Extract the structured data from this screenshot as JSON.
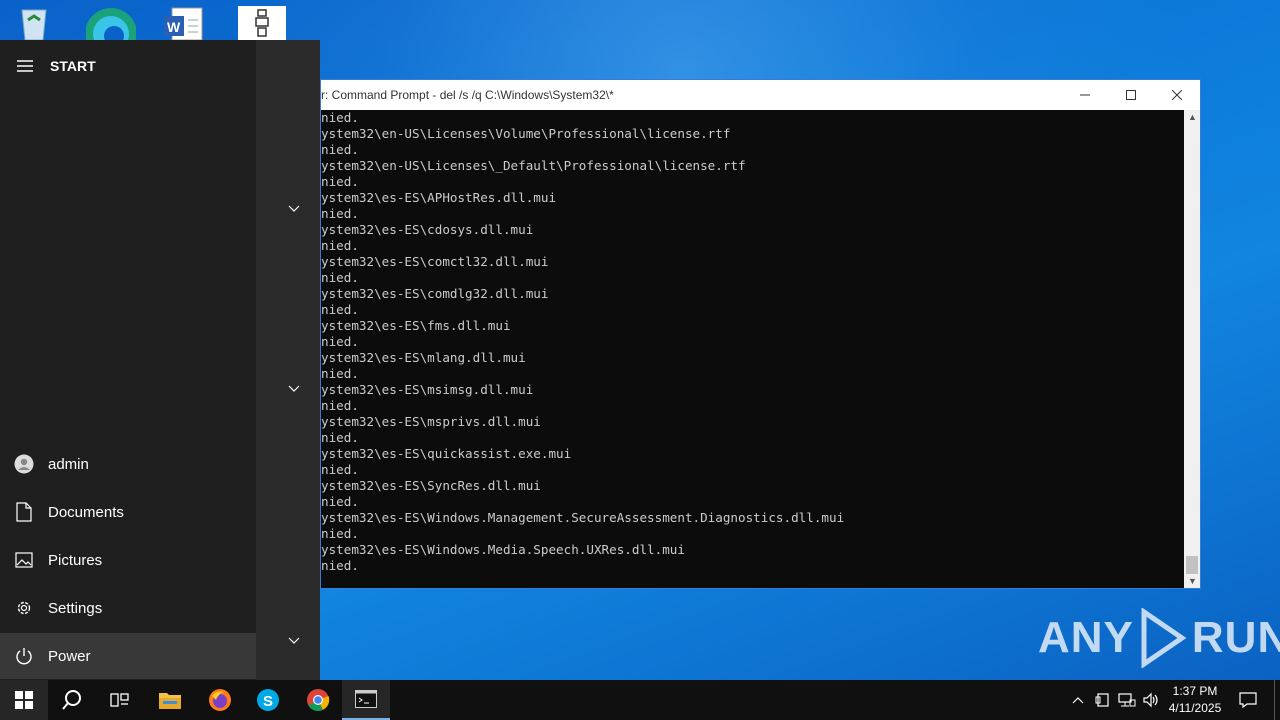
{
  "desktop": {
    "icons": [
      "recycle-bin-icon",
      "edge-icon",
      "word-document-icon",
      "application-icon"
    ]
  },
  "cmd_window": {
    "title": "r: Command Prompt - del  /s /q C:\\Windows\\System32\\*",
    "lines": [
      "nied.",
      "ystem32\\en-US\\Licenses\\Volume\\Professional\\license.rtf",
      "nied.",
      "ystem32\\en-US\\Licenses\\_Default\\Professional\\license.rtf",
      "nied.",
      "ystem32\\es-ES\\APHostRes.dll.mui",
      "nied.",
      "ystem32\\es-ES\\cdosys.dll.mui",
      "nied.",
      "ystem32\\es-ES\\comctl32.dll.mui",
      "nied.",
      "ystem32\\es-ES\\comdlg32.dll.mui",
      "nied.",
      "ystem32\\es-ES\\fms.dll.mui",
      "nied.",
      "ystem32\\es-ES\\mlang.dll.mui",
      "nied.",
      "ystem32\\es-ES\\msimsg.dll.mui",
      "nied.",
      "ystem32\\es-ES\\msprivs.dll.mui",
      "nied.",
      "ystem32\\es-ES\\quickassist.exe.mui",
      "nied.",
      "ystem32\\es-ES\\SyncRes.dll.mui",
      "nied.",
      "ystem32\\es-ES\\Windows.Management.SecureAssessment.Diagnostics.dll.mui",
      "nied.",
      "ystem32\\es-ES\\Windows.Media.Speech.UXRes.dll.mui",
      "nied."
    ]
  },
  "start_menu": {
    "header": "START",
    "items": {
      "user": "admin",
      "documents": "Documents",
      "pictures": "Pictures",
      "settings": "Settings",
      "power": "Power"
    }
  },
  "taskbar": {
    "time": "1:37 PM",
    "date": "4/11/2025",
    "apps": [
      "start",
      "search",
      "task-view",
      "file-explorer",
      "firefox",
      "skype",
      "chrome",
      "command-prompt"
    ]
  },
  "watermark": {
    "left": "ANY",
    "right": "RUN"
  }
}
